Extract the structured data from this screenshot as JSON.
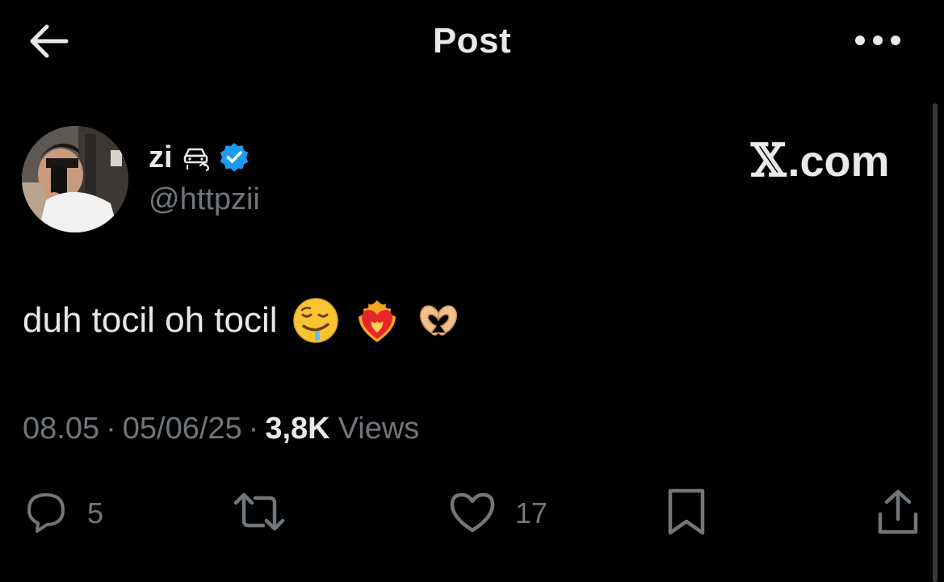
{
  "header": {
    "title": "Post",
    "back_icon": "arrow-left-icon",
    "more_icon": "more-horizontal-icon"
  },
  "author": {
    "display_name": "zi",
    "name_emoji": "car-skidding-emoji",
    "verified": true,
    "handle": "@httpzii"
  },
  "brand": {
    "logo_x": "𝕏",
    "logo_text": ".com"
  },
  "post": {
    "text": "duh tocil oh tocil",
    "emojis": [
      "drooling-face-emoji",
      "heart-on-fire-emoji",
      "heart-hands-emoji"
    ]
  },
  "meta": {
    "time": "08.05",
    "separator": "·",
    "date": "05/06/25",
    "views_count": "3,8K",
    "views_label": "Views"
  },
  "actions": {
    "replies": "5",
    "reposts": "",
    "likes": "17",
    "bookmark_icon": "bookmark-icon",
    "share_icon": "share-icon"
  },
  "colors": {
    "background": "#000000",
    "text_primary": "#e7e9ea",
    "text_secondary": "#71767b",
    "verified_blue": "#1d9bf0"
  }
}
